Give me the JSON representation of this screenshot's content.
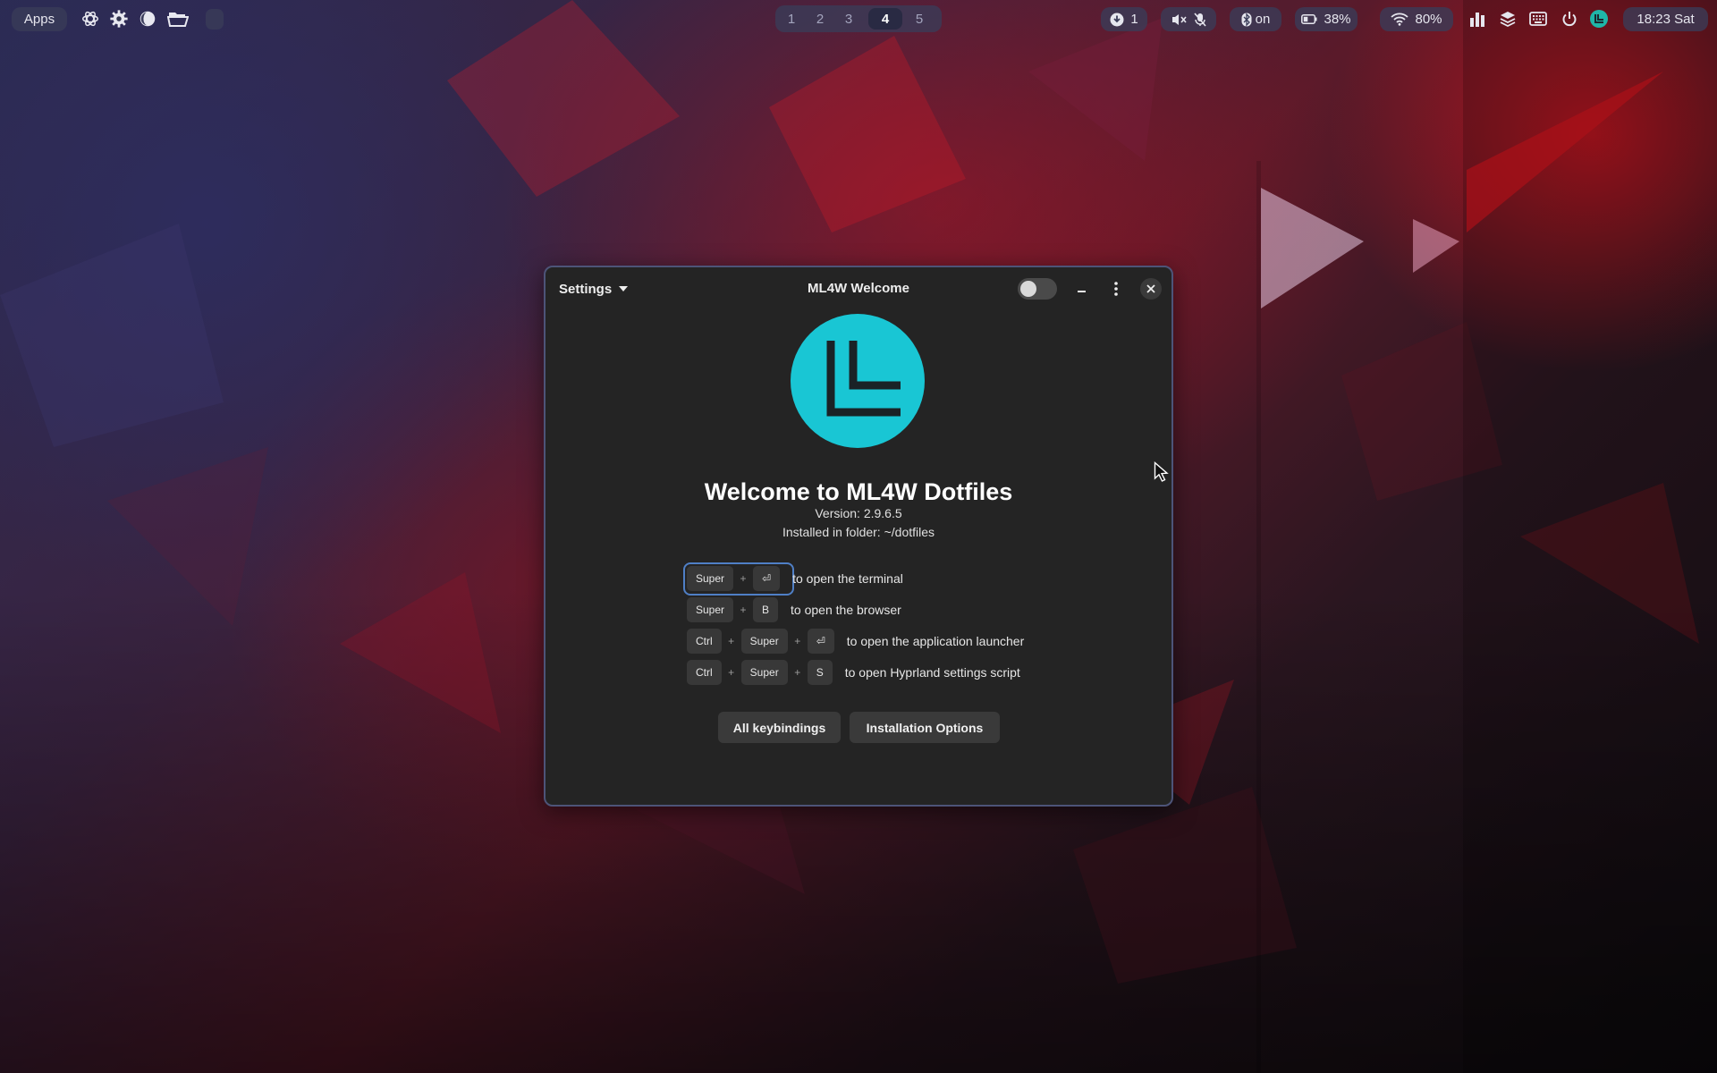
{
  "topbar": {
    "apps_label": "Apps",
    "workspaces": [
      "1",
      "2",
      "3",
      "4",
      "5"
    ],
    "active_workspace": "4",
    "updates": "1",
    "bluetooth": "on",
    "battery": "38%",
    "wifi": "80%",
    "clock": "18:23 Sat",
    "icons": {
      "launcher": [
        "chatgpt-icon",
        "gear-icon",
        "browser-icon",
        "folder-icon"
      ],
      "updates": "download-icon",
      "audio": [
        "speaker-muted-icon",
        "mic-muted-icon"
      ],
      "bluetooth": "bluetooth-icon",
      "battery": "battery-icon",
      "wifi": "wifi-icon",
      "tray": [
        "stats-icon",
        "layers-icon",
        "keyboard-icon",
        "power-icon",
        "app-logo-icon"
      ]
    }
  },
  "window": {
    "settings_menu": "Settings",
    "title": "ML4W Welcome",
    "dark_mode_toggle_on": false,
    "welcome_title": "Welcome to ML4W Dotfiles",
    "version": "Version: 2.9.6.5",
    "folder": "Installed in folder: ~/dotfiles",
    "keybindings": [
      {
        "keys": [
          "Super",
          "⏎"
        ],
        "description": "to open the terminal"
      },
      {
        "keys": [
          "Super",
          "B"
        ],
        "description": "to open the browser"
      },
      {
        "keys": [
          "Ctrl",
          "Super",
          "⏎"
        ],
        "description": "to open the application launcher"
      },
      {
        "keys": [
          "Ctrl",
          "Super",
          "S"
        ],
        "description": "to open Hyprland settings script"
      }
    ],
    "plus": "+",
    "buttons": {
      "all_keybindings": "All keybindings",
      "installation_options": "Installation Options"
    },
    "logo_color": "#19c6d4"
  },
  "colors": {
    "bar_pill": "#3a3c58",
    "window_bg": "#242424",
    "window_border": "#4d5478",
    "focus_ring": "#4f7fc6"
  }
}
